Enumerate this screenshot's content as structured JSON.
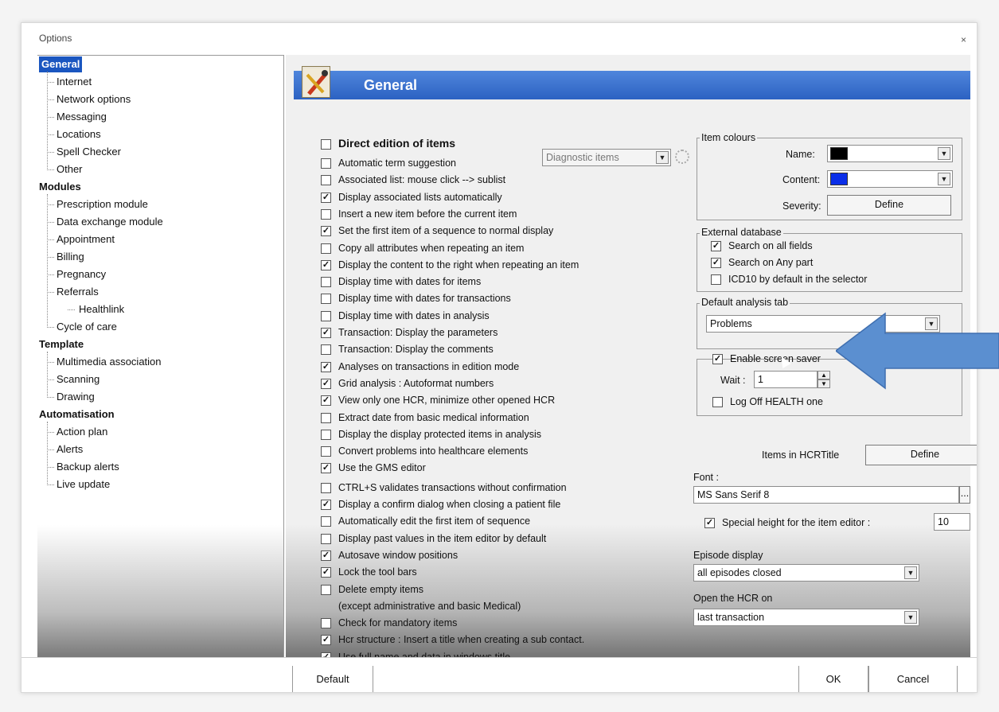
{
  "window": {
    "title": "Options",
    "close_glyph": "×"
  },
  "tree": {
    "items": [
      {
        "label": "General",
        "group": true,
        "selected": true
      },
      {
        "label": "Internet"
      },
      {
        "label": "Network options"
      },
      {
        "label": "Messaging"
      },
      {
        "label": "Locations"
      },
      {
        "label": "Spell Checker"
      },
      {
        "label": "Other"
      },
      {
        "label": "Modules",
        "group": true
      },
      {
        "label": "Prescription module"
      },
      {
        "label": "Data exchange module"
      },
      {
        "label": "Appointment"
      },
      {
        "label": "Billing"
      },
      {
        "label": "Pregnancy"
      },
      {
        "label": "Referrals"
      },
      {
        "label": "Healthlink"
      },
      {
        "label": "Cycle of care"
      },
      {
        "label": "Template",
        "group": true
      },
      {
        "label": "Multimedia association"
      },
      {
        "label": "Scanning"
      },
      {
        "label": "Drawing"
      },
      {
        "label": "Automatisation",
        "group": true
      },
      {
        "label": "Action plan"
      },
      {
        "label": "Alerts"
      },
      {
        "label": "Backup alerts"
      },
      {
        "label": "Live update"
      }
    ]
  },
  "panel": {
    "header": "General",
    "options": [
      {
        "label": "Direct edition of items",
        "checked": false,
        "bold": true
      },
      {
        "label": "Automatic term suggestion",
        "checked": false
      },
      {
        "label": "Associated list: mouse click --> sublist",
        "checked": false
      },
      {
        "label": "Display associated lists automatically",
        "checked": true
      },
      {
        "label": "Insert a new item before the current item",
        "checked": false
      },
      {
        "label": "Set the first item of a sequence to normal display",
        "checked": true
      },
      {
        "label": "Copy all attributes when repeating an item",
        "checked": false
      },
      {
        "label": "Display the content to the right when repeating an item",
        "checked": true
      },
      {
        "label": "Display time with dates for items",
        "checked": false
      },
      {
        "label": "Display time with dates for transactions",
        "checked": false
      },
      {
        "label": "Display time with dates in analysis",
        "checked": false
      },
      {
        "label": "Transaction: Display the parameters",
        "checked": true
      },
      {
        "label": "Transaction: Display the comments",
        "checked": false
      },
      {
        "label": "Analyses on transactions in edition mode",
        "checked": true
      },
      {
        "label": "Grid analysis : Autoformat numbers",
        "checked": true
      },
      {
        "label": "View only one HCR, minimize other opened HCR",
        "checked": true
      },
      {
        "label": "Extract date from basic medical information",
        "checked": false
      },
      {
        "label": "Display the display protected items in analysis",
        "checked": false
      },
      {
        "label": "Convert problems into healthcare elements",
        "checked": false
      },
      {
        "label": "Use the GMS editor",
        "checked": true,
        "gap_after": true
      },
      {
        "label": "CTRL+S validates transactions without confirmation",
        "checked": false
      },
      {
        "label": "Display a confirm dialog when closing a patient file",
        "checked": true
      },
      {
        "label": "Automatically edit the first item of sequence",
        "checked": false
      },
      {
        "label": "Display past values in the item editor by default",
        "checked": false
      },
      {
        "label": "Autosave window positions",
        "checked": true
      },
      {
        "label": "Lock the tool bars",
        "checked": true
      },
      {
        "label": "Delete empty items",
        "checked": false
      },
      {
        "label": "(except administrative and basic Medical)",
        "no_checkbox": true
      },
      {
        "label": "Check for mandatory items",
        "checked": false
      },
      {
        "label": "Hcr structure : Insert a title when creating a sub contact.",
        "checked": true
      },
      {
        "label": "Use full name and data in windows title",
        "checked": true
      }
    ],
    "term_suggestion_combo": "Diagnostic items",
    "item_colours": {
      "legend": "Item colours",
      "name_label": "Name:",
      "content_label": "Content:",
      "severity_label": "Severity:",
      "define_label": "Define",
      "name_color": "#000000",
      "content_color": "#0a2ee8"
    },
    "external_database": {
      "legend": "External database",
      "options": [
        {
          "label": "Search on all fields",
          "checked": true
        },
        {
          "label": "Search on Any part",
          "checked": true
        },
        {
          "label": "ICD10 by default in the selector",
          "checked": false
        }
      ]
    },
    "default_analysis": {
      "legend": "Default analysis tab",
      "value": "Problems"
    },
    "screen_saver": {
      "enable_label": "Enable screen saver",
      "enable_checked": true,
      "wait_label": "Wait :",
      "wait_value": "1",
      "logoff_label": "Log Off HEALTH one",
      "logoff_checked": false
    },
    "items_hcr_title": {
      "label": "Items in HCRTitle",
      "button": "Define"
    },
    "font": {
      "label": "Font :",
      "value": "MS Sans Serif 8",
      "browse": "..."
    },
    "special_height": {
      "label": "Special height for the item editor :",
      "checked": true,
      "value": "10"
    },
    "episode_display": {
      "label": "Episode display",
      "value": "all episodes closed"
    },
    "open_hcr": {
      "label": "Open the HCR on",
      "value": "last transaction"
    }
  },
  "buttons": {
    "default": "Default",
    "ok": "OK",
    "cancel": "Cancel"
  },
  "colors": {
    "accent": "#2c62c2",
    "arrow": "#5b8fd0"
  }
}
